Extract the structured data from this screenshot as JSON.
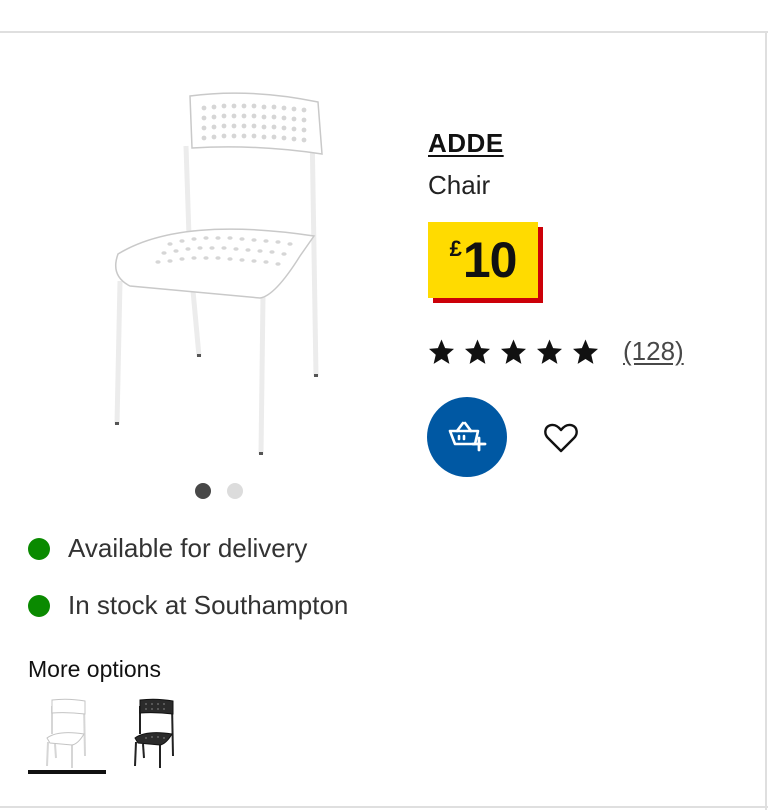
{
  "product": {
    "name": "ADDE",
    "type": "Chair",
    "price": {
      "currency": "£",
      "amount": "10"
    },
    "rating": {
      "stars": 5,
      "max": 5,
      "count_label": "(128)"
    },
    "image": {
      "icon": "chair-white-image"
    }
  },
  "carousel": {
    "dot_count": 2,
    "active_index": 0
  },
  "actions": {
    "add_to_basket_icon": "basket-plus-icon",
    "favourite_icon": "heart-outline-icon"
  },
  "availability": [
    {
      "text": "Available for delivery",
      "status_color": "#0a8a00"
    },
    {
      "text": "In stock at Southampton",
      "status_color": "#0a8a00"
    }
  ],
  "more_options": {
    "label": "More options",
    "variants": [
      {
        "color": "white",
        "selected": true
      },
      {
        "color": "black",
        "selected": false
      }
    ]
  },
  "colors": {
    "price_background": "#ffdb00",
    "price_shadow": "#cc0008",
    "basket_button": "#0058a3",
    "in_stock": "#0a8a00"
  }
}
